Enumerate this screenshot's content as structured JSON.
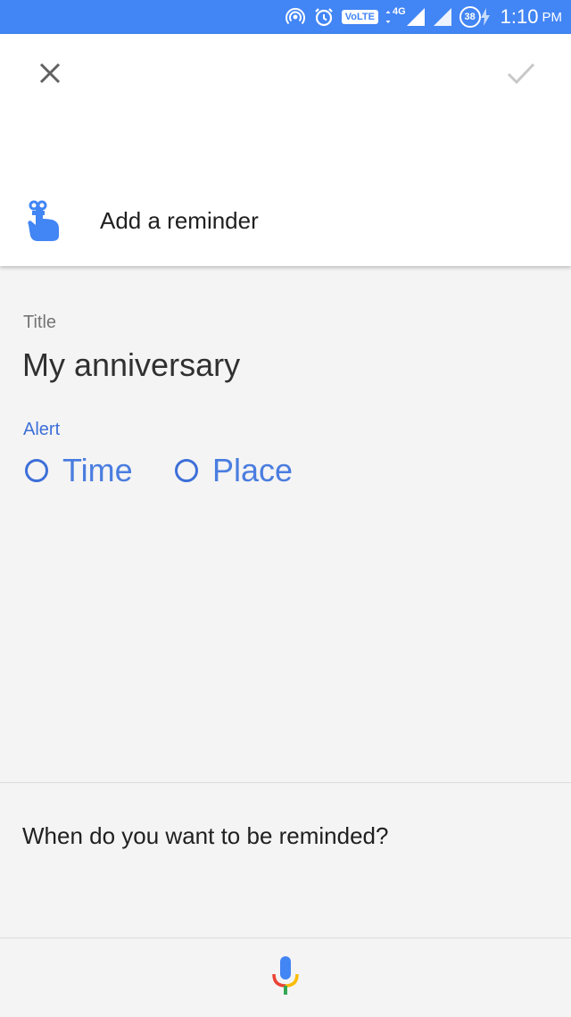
{
  "status_bar": {
    "volte": "VoLTE",
    "network": "4G",
    "battery": "38",
    "time": "1:10",
    "ampm": "PM",
    "icons": [
      "hotspot-icon",
      "alarm-icon",
      "volte-icon",
      "signal-icon",
      "signal-roaming-icon",
      "battery-charging-icon"
    ]
  },
  "header": {
    "close_icon": "close-icon",
    "confirm_icon": "check-icon",
    "reminder_icon": "finger-string-icon",
    "reminder_label": "Add a reminder"
  },
  "form": {
    "title_label": "Title",
    "title_value": "My anniversary",
    "alert_label": "Alert",
    "alert_options": [
      {
        "label": "Time",
        "selected": false
      },
      {
        "label": "Place",
        "selected": false
      }
    ]
  },
  "prompt": {
    "text": "When do you want to be reminded?"
  },
  "mic": {
    "icon": "microphone-icon"
  },
  "colors": {
    "status_bar": "#4285f4",
    "accent": "#3d6fd8",
    "background": "#f4f4f4"
  }
}
